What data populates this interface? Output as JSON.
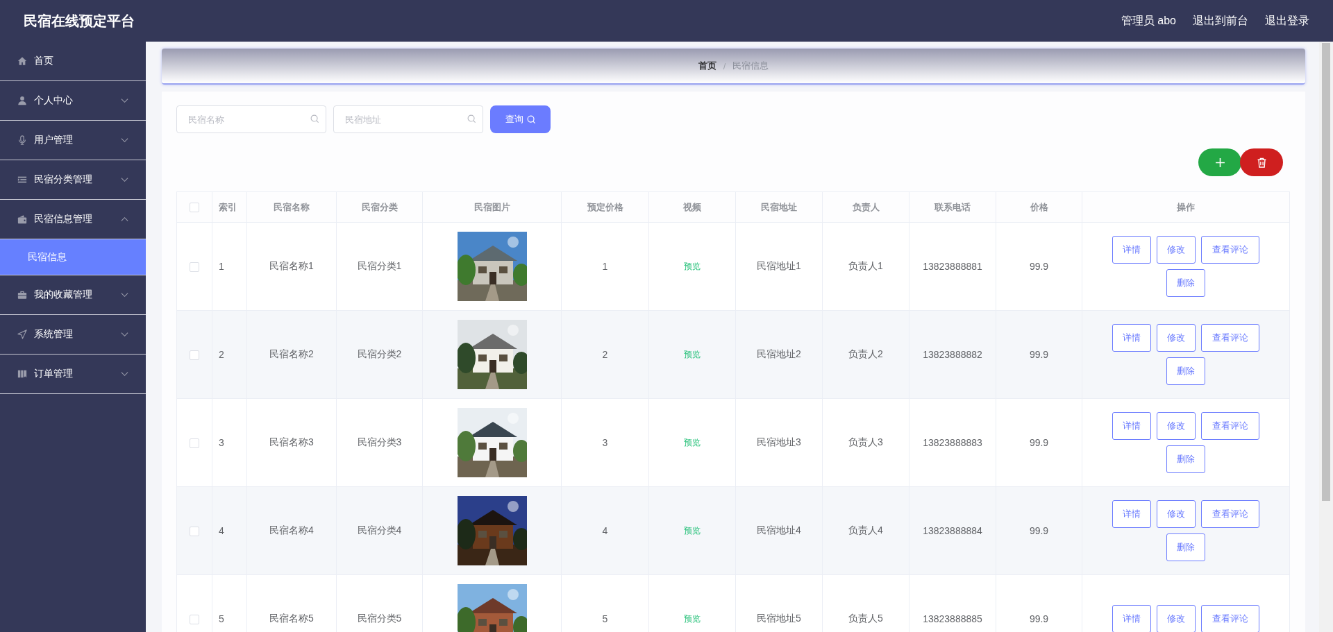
{
  "app_title": "民宿在线预定平台",
  "header_links": [
    "管理员 abo",
    "退出到前台",
    "退出登录"
  ],
  "sidebar": {
    "items": [
      {
        "label": "首页",
        "kind": "link"
      },
      {
        "label": "个人中心",
        "kind": "menu",
        "expanded": false
      },
      {
        "label": "用户管理",
        "kind": "menu",
        "expanded": false
      },
      {
        "label": "民宿分类管理",
        "kind": "menu",
        "expanded": false
      },
      {
        "label": "民宿信息管理",
        "kind": "menu",
        "expanded": true,
        "children": [
          {
            "label": "民宿信息",
            "selected": true
          }
        ]
      },
      {
        "label": "我的收藏管理",
        "kind": "menu",
        "expanded": false
      },
      {
        "label": "系统管理",
        "kind": "menu",
        "expanded": false
      },
      {
        "label": "订单管理",
        "kind": "menu",
        "expanded": false
      }
    ]
  },
  "breadcrumb": {
    "items": [
      "首页",
      "民宿信息"
    ],
    "separator": "/"
  },
  "search": {
    "fields": [
      {
        "placeholder": "民宿名称"
      },
      {
        "placeholder": "民宿地址"
      }
    ],
    "button": "查询"
  },
  "table": {
    "select_all": {
      "checked": false
    },
    "columns": [
      "索引",
      "民宿名称",
      "民宿分类",
      "民宿图片",
      "预定价格",
      "视频",
      "民宿地址",
      "负责人",
      "联系电话",
      "价格",
      "操作"
    ],
    "rows": [
      {
        "checked": false,
        "index": "1",
        "name": "民宿名称1",
        "category": "民宿分类1",
        "image": {
          "kind": "picture"
        },
        "booking_price": "1",
        "video": "预览",
        "address": "民宿地址1",
        "owner": "负责人1",
        "phone": "13823888881",
        "price": "99.9",
        "actions": [
          "详情",
          "修改",
          "查看评论",
          "删除"
        ]
      },
      {
        "checked": false,
        "index": "2",
        "name": "民宿名称2",
        "category": "民宿分类2",
        "image": {
          "kind": "picture"
        },
        "booking_price": "2",
        "video": "预览",
        "address": "民宿地址2",
        "owner": "负责人2",
        "phone": "13823888882",
        "price": "99.9",
        "actions": [
          "详情",
          "修改",
          "查看评论",
          "删除"
        ]
      },
      {
        "checked": false,
        "index": "3",
        "name": "民宿名称3",
        "category": "民宿分类3",
        "image": {
          "kind": "picture"
        },
        "booking_price": "3",
        "video": "预览",
        "address": "民宿地址3",
        "owner": "负责人3",
        "phone": "13823888883",
        "price": "99.9",
        "actions": [
          "详情",
          "修改",
          "查看评论",
          "删除"
        ]
      },
      {
        "checked": false,
        "index": "4",
        "name": "民宿名称4",
        "category": "民宿分类4",
        "image": {
          "kind": "picture"
        },
        "booking_price": "4",
        "video": "预览",
        "address": "民宿地址4",
        "owner": "负责人4",
        "phone": "13823888884",
        "price": "99.9",
        "actions": [
          "详情",
          "修改",
          "查看评论",
          "删除"
        ]
      },
      {
        "checked": false,
        "index": "5",
        "name": "民宿名称5",
        "category": "民宿分类5",
        "image": {
          "kind": "picture"
        },
        "booking_price": "5",
        "video": "预览",
        "address": "民宿地址5",
        "owner": "负责人5",
        "phone": "13823888885",
        "price": "99.9",
        "actions": [
          "详情",
          "修改",
          "查看评论"
        ]
      }
    ]
  }
}
